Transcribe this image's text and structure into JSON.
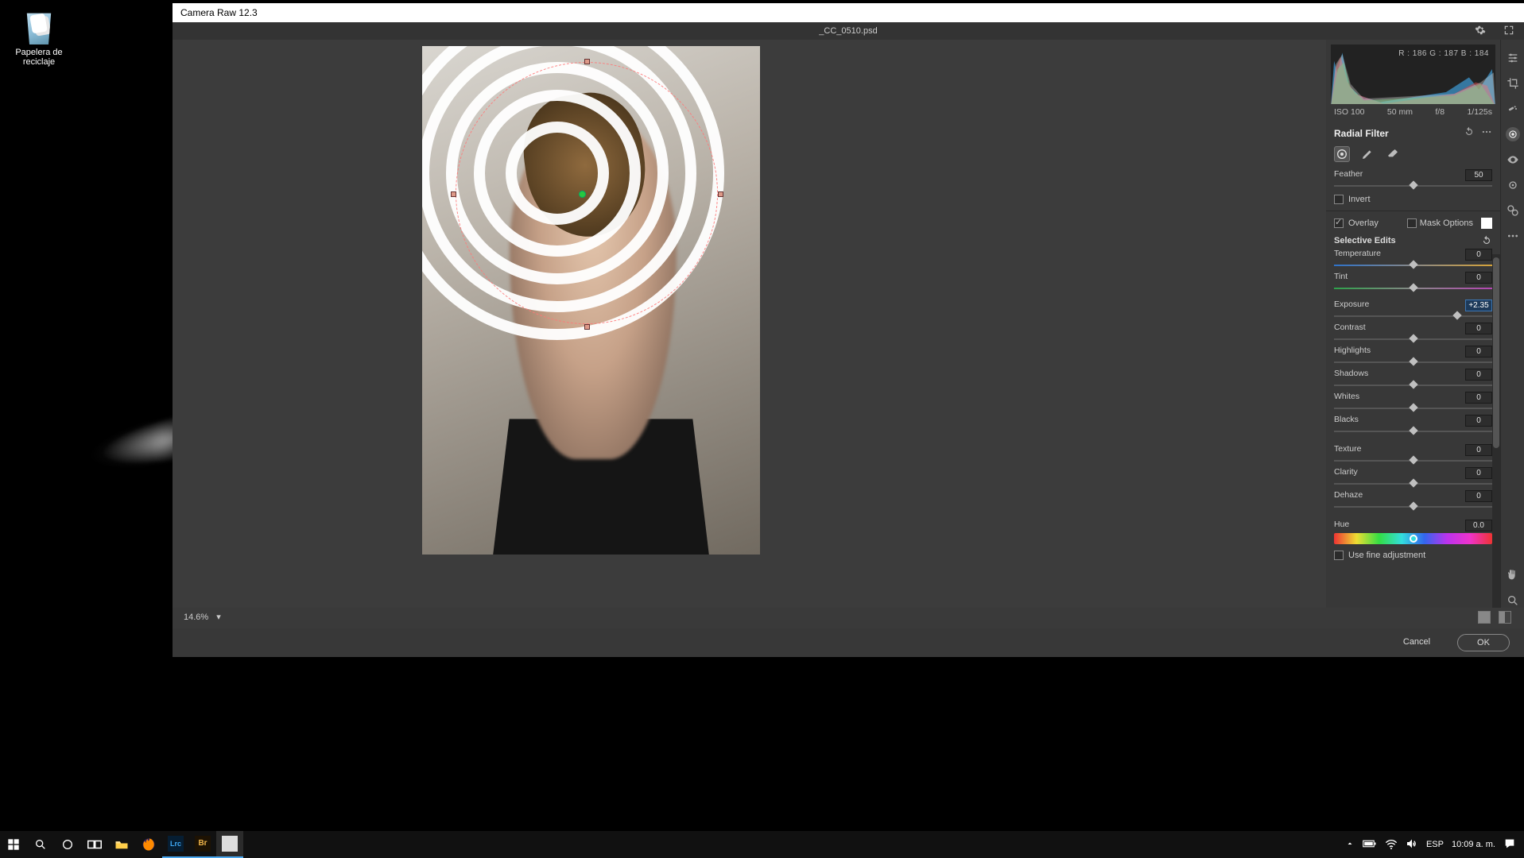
{
  "desktop": {
    "recycle_label": "Papelera de\nreciclaje"
  },
  "window": {
    "title": "Camera Raw 12.3",
    "filename": "_CC_0510.psd"
  },
  "histogram": {
    "readout": "R : 186    G : 187    B : 184"
  },
  "exif": {
    "iso": "ISO 100",
    "focal": "50 mm",
    "aperture": "f/8",
    "shutter": "1/125s"
  },
  "panel": {
    "title": "Radial Filter",
    "feather_label": "Feather",
    "feather_value": "50",
    "invert_label": "Invert",
    "overlay_label": "Overlay",
    "maskopts_label": "Mask Options",
    "selective_label": "Selective Edits",
    "fineadj_label": "Use fine adjustment"
  },
  "sliders": {
    "temperature": {
      "label": "Temperature",
      "value": "0",
      "pos": 50
    },
    "tint": {
      "label": "Tint",
      "value": "0",
      "pos": 50
    },
    "exposure": {
      "label": "Exposure",
      "value": "+2.35",
      "pos": 78
    },
    "contrast": {
      "label": "Contrast",
      "value": "0",
      "pos": 50
    },
    "highlights": {
      "label": "Highlights",
      "value": "0",
      "pos": 50
    },
    "shadows": {
      "label": "Shadows",
      "value": "0",
      "pos": 50
    },
    "whites": {
      "label": "Whites",
      "value": "0",
      "pos": 50
    },
    "blacks": {
      "label": "Blacks",
      "value": "0",
      "pos": 50
    },
    "texture": {
      "label": "Texture",
      "value": "0",
      "pos": 50
    },
    "clarity": {
      "label": "Clarity",
      "value": "0",
      "pos": 50
    },
    "dehaze": {
      "label": "Dehaze",
      "value": "0",
      "pos": 50
    },
    "hue": {
      "label": "Hue",
      "value": "0.0",
      "pos": 50
    }
  },
  "buttons": {
    "cancel": "Cancel",
    "ok": "OK"
  },
  "zoom": "14.6%",
  "taskbar": {
    "lang": "ESP",
    "time": "10:09 a. m."
  }
}
